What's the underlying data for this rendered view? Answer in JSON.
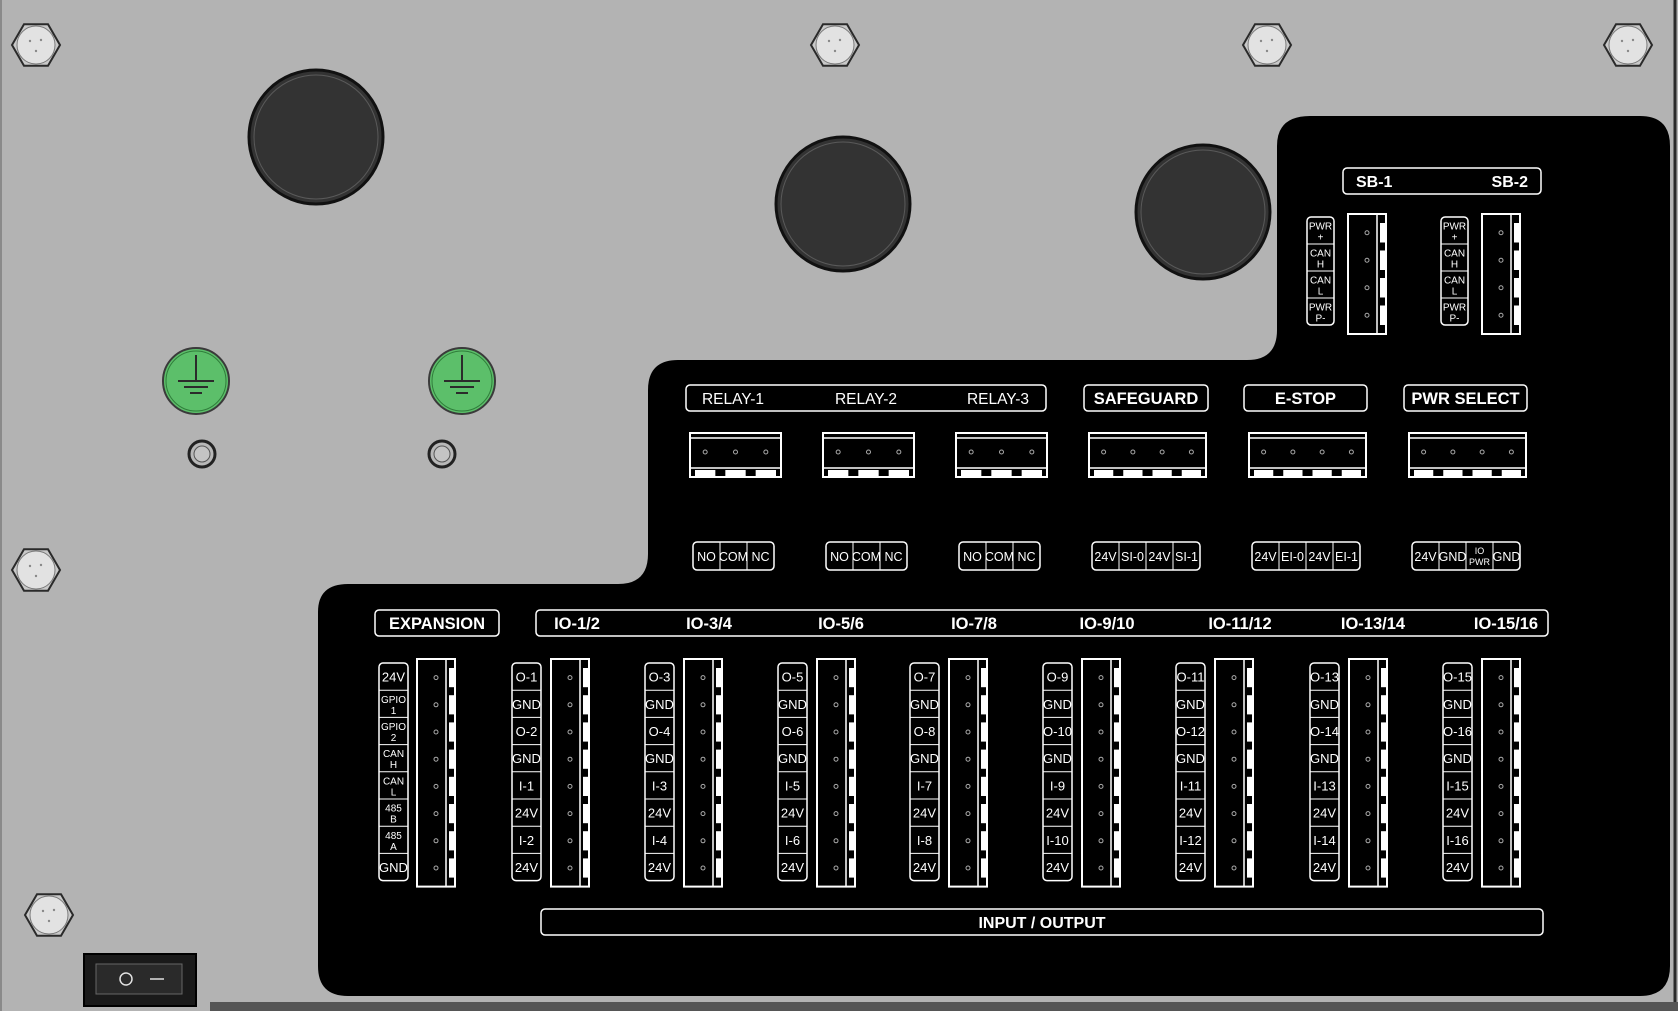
{
  "colors": {
    "panel_bg": "#b3b3b3",
    "board": "#000000",
    "knob": "#333333",
    "ground_green": "#5cbf6a",
    "outline": "#ffffff"
  },
  "icons": {
    "screw": "hex-screw-icon",
    "ground": "protective-earth-icon",
    "switch": "rocker-switch-icon"
  },
  "sb": {
    "label_1": "SB-1",
    "label_2": "SB-2",
    "pins": [
      [
        "PWR",
        "+"
      ],
      [
        "CAN",
        "H"
      ],
      [
        "CAN",
        "L"
      ],
      [
        "PWR",
        "P-"
      ]
    ]
  },
  "relay": {
    "labels": [
      "RELAY-1",
      "RELAY-2",
      "RELAY-3"
    ],
    "pins": [
      "NO",
      "COM",
      "NC"
    ]
  },
  "safeguard": {
    "label": "SAFEGUARD",
    "pins": [
      "24V",
      "SI-0",
      "24V",
      "SI-1"
    ]
  },
  "estop": {
    "label": "E-STOP",
    "pins": [
      "24V",
      "EI-0",
      "24V",
      "EI-1"
    ]
  },
  "pwr_select": {
    "label": "PWR SELECT",
    "pins": [
      "24V",
      "GND",
      [
        "IO",
        "PWR"
      ],
      "GND"
    ]
  },
  "expansion": {
    "label": "EXPANSION",
    "pins": [
      "24V",
      [
        "GPIO",
        "1"
      ],
      [
        "GPIO",
        "2"
      ],
      [
        "CAN",
        "H"
      ],
      [
        "CAN",
        "L"
      ],
      [
        "485",
        "B"
      ],
      [
        "485",
        "A"
      ],
      "GND"
    ]
  },
  "io": {
    "labels": [
      "IO-1/2",
      "IO-3/4",
      "IO-5/6",
      "IO-7/8",
      "IO-9/10",
      "IO-11/12",
      "IO-13/14",
      "IO-15/16"
    ],
    "pins": [
      [
        "O-1",
        "GND",
        "O-2",
        "GND",
        "I-1",
        "24V",
        "I-2",
        "24V"
      ],
      [
        "O-3",
        "GND",
        "O-4",
        "GND",
        "I-3",
        "24V",
        "I-4",
        "24V"
      ],
      [
        "O-5",
        "GND",
        "O-6",
        "GND",
        "I-5",
        "24V",
        "I-6",
        "24V"
      ],
      [
        "O-7",
        "GND",
        "O-8",
        "GND",
        "I-7",
        "24V",
        "I-8",
        "24V"
      ],
      [
        "O-9",
        "GND",
        "O-10",
        "GND",
        "I-9",
        "24V",
        "I-10",
        "24V"
      ],
      [
        "O-11",
        "GND",
        "O-12",
        "GND",
        "I-11",
        "24V",
        "I-12",
        "24V"
      ],
      [
        "O-13",
        "GND",
        "O-14",
        "GND",
        "I-13",
        "24V",
        "I-14",
        "24V"
      ],
      [
        "O-15",
        "GND",
        "O-16",
        "GND",
        "I-15",
        "24V",
        "I-16",
        "24V"
      ]
    ],
    "footer": "INPUT / OUTPUT"
  }
}
